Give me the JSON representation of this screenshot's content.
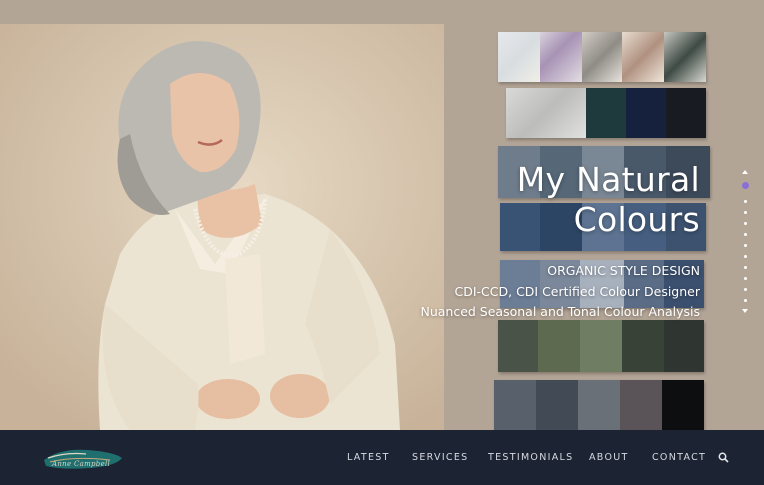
{
  "hero": {
    "title_line1": "My Natural",
    "title_line2": "Colours",
    "subtitle1": "ORGANIC STYLE DESIGN",
    "subtitle2": "CDI-CCD, CDI Certified Colour Designer",
    "subtitle3": "Nuanced Seasonal and Tonal Colour Analysis"
  },
  "slider": {
    "dot_count": 12,
    "active_index": 0
  },
  "logo": {
    "text": "Anne Campbell"
  },
  "nav": {
    "items": [
      {
        "label": "LATEST"
      },
      {
        "label": "SERVICES"
      },
      {
        "label": "TESTIMONIALS"
      },
      {
        "label": "ABOUT"
      },
      {
        "label": "CONTACT"
      }
    ],
    "search_icon": "search-icon"
  },
  "colors": {
    "background": "#b3a596",
    "navbar": "#1c2434",
    "active_dot": "#8a6fd8",
    "logo_teal": "#1f6f6f"
  }
}
